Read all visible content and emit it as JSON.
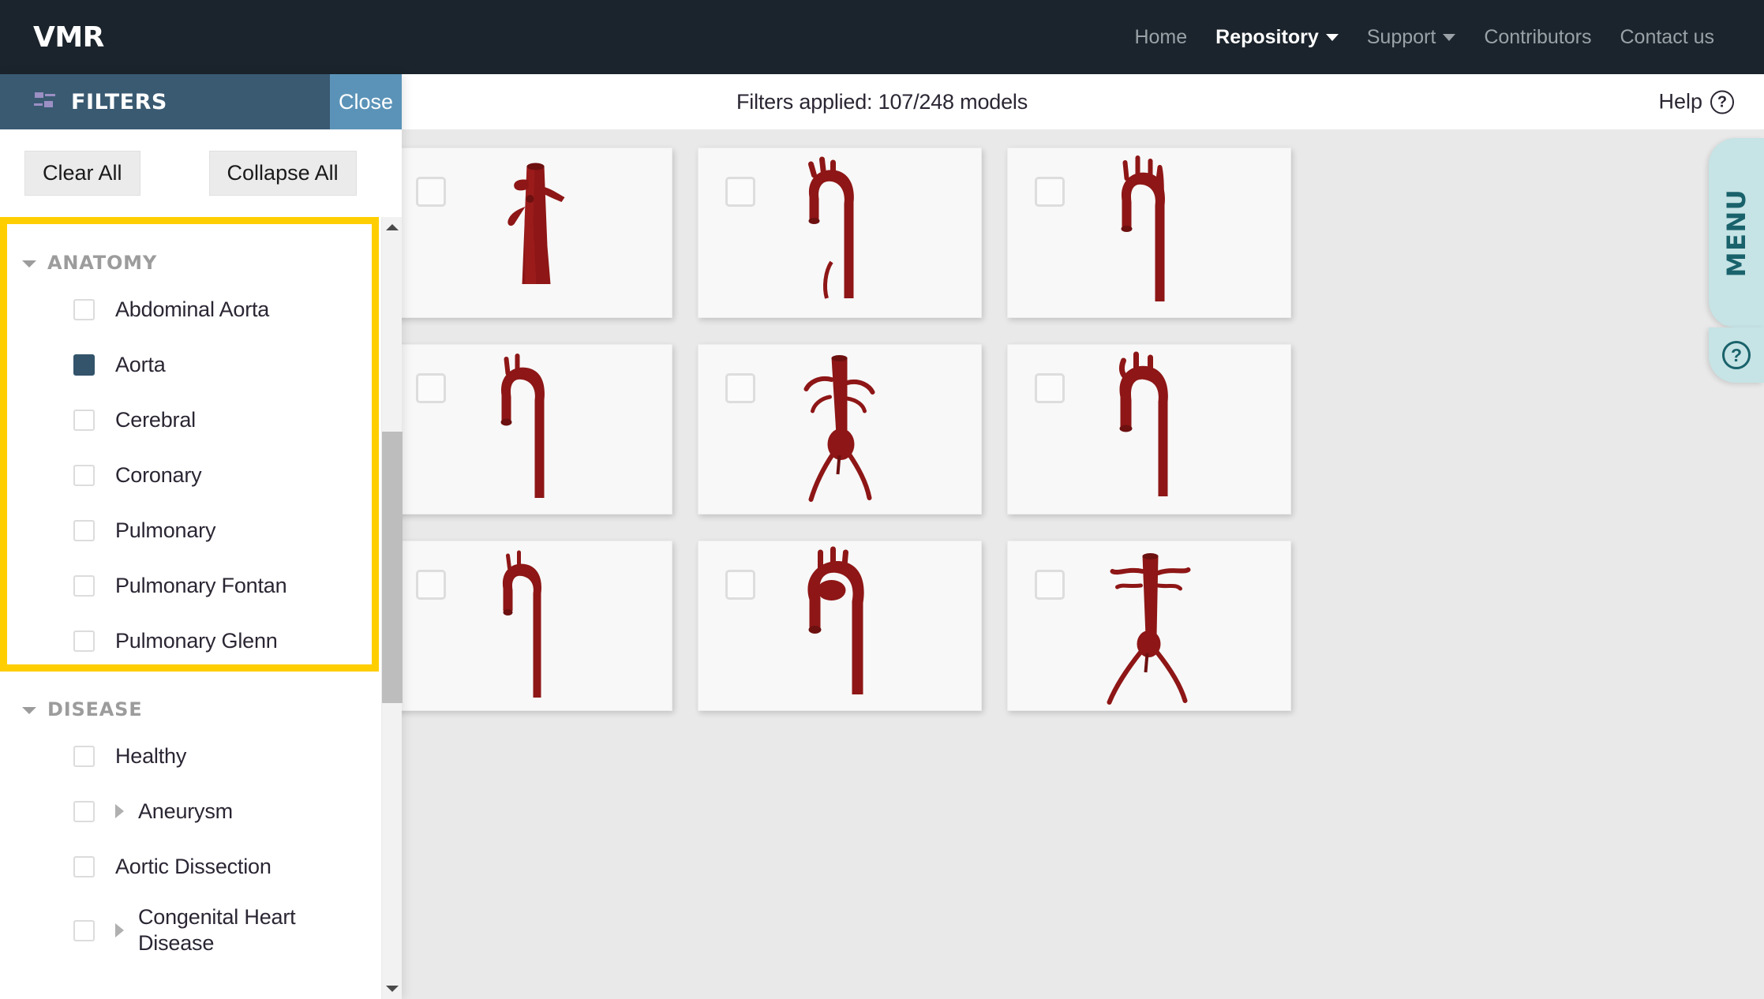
{
  "navbar": {
    "brand": "VMR",
    "links": [
      {
        "label": "Home",
        "active": false,
        "dropdown": false
      },
      {
        "label": "Repository",
        "active": true,
        "dropdown": true
      },
      {
        "label": "Support",
        "active": false,
        "dropdown": true
      },
      {
        "label": "Contributors",
        "active": false,
        "dropdown": false
      },
      {
        "label": "Contact us",
        "active": false,
        "dropdown": false
      }
    ]
  },
  "subheader": {
    "filters_applied": "Filters applied: 107/248 models",
    "help_label": "Help",
    "help_icon": "question-circle-icon"
  },
  "filter_panel": {
    "header_title": "FILTERS",
    "header_icon": "sliders-icon",
    "close_label": "Close",
    "clear_all_label": "Clear All",
    "collapse_all_label": "Collapse All",
    "selected_color": "#33546b",
    "highlight_color": "#ffce00",
    "groups": [
      {
        "title": "ANATOMY",
        "expanded": true,
        "highlighted": true,
        "options": [
          {
            "label": "Abdominal Aorta",
            "checked": false,
            "expandable": false
          },
          {
            "label": "Aorta",
            "checked": true,
            "expandable": false
          },
          {
            "label": "Cerebral",
            "checked": false,
            "expandable": false
          },
          {
            "label": "Coronary",
            "checked": false,
            "expandable": false
          },
          {
            "label": "Pulmonary",
            "checked": false,
            "expandable": false
          },
          {
            "label": "Pulmonary Fontan",
            "checked": false,
            "expandable": false
          },
          {
            "label": "Pulmonary Glenn",
            "checked": false,
            "expandable": false
          }
        ]
      },
      {
        "title": "DISEASE",
        "expanded": true,
        "highlighted": false,
        "options": [
          {
            "label": "Healthy",
            "checked": false,
            "expandable": false
          },
          {
            "label": "Aneurysm",
            "checked": false,
            "expandable": true
          },
          {
            "label": "Aortic Dissection",
            "checked": false,
            "expandable": false
          },
          {
            "label": "Congenital Heart Disease",
            "checked": false,
            "expandable": true
          }
        ]
      }
    ],
    "scrollbar": {
      "up_icon": "triangle-up-icon",
      "down_icon": "triangle-down-icon"
    }
  },
  "menu_tab": {
    "label": "MENU",
    "help_icon": "question-circle-icon",
    "background": "#c6e3e5",
    "text_color": "#19626b"
  },
  "grid": {
    "model_color": "#8e1616",
    "cards": [
      {
        "row": 0,
        "col": 0,
        "checked": false,
        "shape": "partial"
      },
      {
        "row": 0,
        "col": 1,
        "checked": false,
        "shape": "abdominal-aorta-trunk"
      },
      {
        "row": 0,
        "col": 2,
        "checked": false,
        "shape": "aortic-arch-descending"
      },
      {
        "row": 0,
        "col": 3,
        "checked": false,
        "shape": "aortic-arch-branches"
      },
      {
        "row": 1,
        "col": 0,
        "checked": false,
        "shape": "partial"
      },
      {
        "row": 1,
        "col": 1,
        "checked": false,
        "shape": "aortic-arch-hook"
      },
      {
        "row": 1,
        "col": 2,
        "checked": false,
        "shape": "abdominal-aorta-bifurcation"
      },
      {
        "row": 1,
        "col": 3,
        "checked": false,
        "shape": "aortic-arch-three-branch"
      },
      {
        "row": 2,
        "col": 0,
        "checked": false,
        "shape": "partial"
      },
      {
        "row": 2,
        "col": 1,
        "checked": false,
        "shape": "aortic-arch-slim"
      },
      {
        "row": 2,
        "col": 2,
        "checked": false,
        "shape": "aortic-arch-wide"
      },
      {
        "row": 2,
        "col": 3,
        "checked": false,
        "shape": "full-aorta-iliac"
      }
    ]
  }
}
